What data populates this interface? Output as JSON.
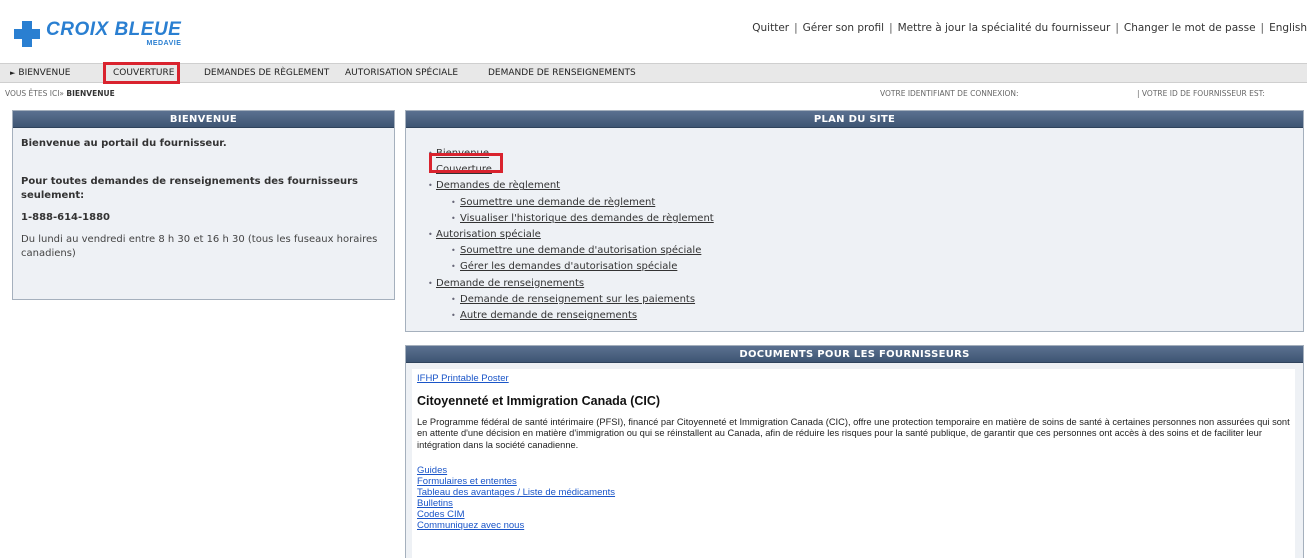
{
  "brand": {
    "name": "CROIX BLEUE",
    "sub": "MEDAVIE",
    "color": "#2a7fd1"
  },
  "top_links": [
    "Quitter",
    "Gérer son profil",
    "Mettre à jour la spécialité du fournisseur",
    "Changer le mot de passe",
    "English"
  ],
  "nav": {
    "items": [
      "Bienvenue",
      "Couverture",
      "Demandes de règlement",
      "Autorisation spéciale",
      "Demande de renseignements"
    ],
    "highlight_color": "#d9232e"
  },
  "crumbs": {
    "you_are_here": "Vous êtes ici»",
    "current": "Bienvenue",
    "login_id_label": "Votre identifiant de connexion:",
    "provider_id_label": "| Votre ID de fournisseur est:"
  },
  "welcome_panel": {
    "title": "Bienvenue",
    "intro": "Bienvenue au portail du fournisseur.",
    "inquiries": "Pour toutes demandes de renseignements des fournisseurs seulement:",
    "phone": "1-888-614-1880",
    "hours": "Du lundi au vendredi entre 8 h 30 et 16 h 30 (tous les fuseaux horaires canadiens)"
  },
  "sitemap": {
    "title": "Plan du site",
    "items": {
      "bienvenue": "Bienvenue",
      "couverture": "Couverture",
      "reglement": "Demandes de règlement",
      "soumettre_reglement": "Soumettre une demande de règlement",
      "historique_reglement": "Visualiser l'historique des demandes de règlement",
      "autorisation": "Autorisation spéciale",
      "soumettre_autorisation": "Soumettre une demande d'autorisation spéciale",
      "gerer_autorisation": "Gérer les demandes d'autorisation spéciale",
      "renseignements": "Demande de renseignements",
      "paiements": "Demande de renseignement sur les paiements",
      "autre": "Autre demande de renseignements"
    }
  },
  "documents": {
    "title": "Documents pour les fournisseurs",
    "poster_link": "IFHP Printable Poster",
    "heading": "Citoyenneté et Immigration Canada (CIC)",
    "paragraph": "Le Programme fédéral de santé intérimaire (PFSI), financé par Citoyenneté et Immigration Canada (CIC), offre une protection temporaire en matière de soins de santé à certaines personnes non assurées qui sont en attente d'une décision en matière d'immigration ou qui se réinstallent au Canada, afin de réduire les risques pour la santé publique, de garantir que ces personnes ont accès à des soins et de faciliter leur intégration dans la société canadienne.",
    "links": [
      "Guides",
      "Formulaires et ententes",
      "Tableau des avantages / Liste de médicaments",
      "Bulletins",
      "Codes CIM",
      "Communiquez avec nous"
    ]
  }
}
